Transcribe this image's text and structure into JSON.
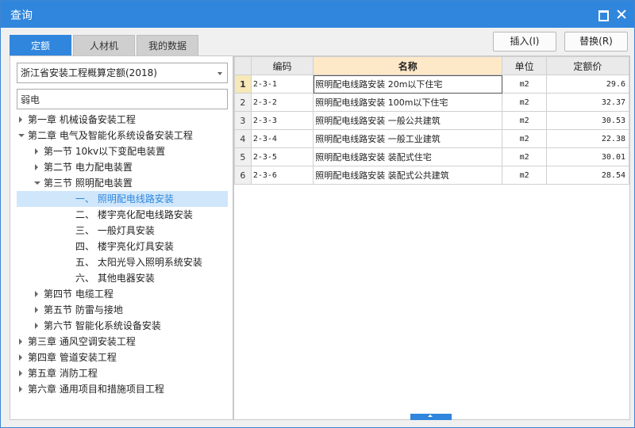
{
  "window": {
    "title": "查询"
  },
  "tabs": [
    {
      "label": "定额"
    },
    {
      "label": "人材机"
    },
    {
      "label": "我的数据"
    }
  ],
  "toolbar": {
    "insert_label": "插入(I)",
    "replace_label": "替换(R)"
  },
  "library": {
    "selected": "浙江省安装工程概算定额(2018)"
  },
  "search": {
    "value": "弱电"
  },
  "tree": [
    {
      "label": "第一章 机械设备安装工程",
      "level": 0,
      "arrow": "right"
    },
    {
      "label": "第二章 电气及智能化系统设备安装工程",
      "level": 0,
      "arrow": "down"
    },
    {
      "label": "第一节 10kv以下变配电装置",
      "level": 1,
      "arrow": "right"
    },
    {
      "label": "第二节 电力配电装置",
      "level": 1,
      "arrow": "right"
    },
    {
      "label": "第三节 照明配电装置",
      "level": 1,
      "arrow": "down"
    },
    {
      "label": "一、 照明配电线路安装",
      "level": 2,
      "arrow": "none",
      "selected": true
    },
    {
      "label": "二、 楼宇亮化配电线路安装",
      "level": 2,
      "arrow": "none"
    },
    {
      "label": "三、 一般灯具安装",
      "level": 2,
      "arrow": "none"
    },
    {
      "label": "四、 楼宇亮化灯具安装",
      "level": 2,
      "arrow": "none"
    },
    {
      "label": "五、 太阳光导入照明系统安装",
      "level": 2,
      "arrow": "none"
    },
    {
      "label": "六、 其他电器安装",
      "level": 2,
      "arrow": "none"
    },
    {
      "label": "第四节 电缆工程",
      "level": 1,
      "arrow": "right"
    },
    {
      "label": "第五节 防雷与接地",
      "level": 1,
      "arrow": "right"
    },
    {
      "label": "第六节 智能化系统设备安装",
      "level": 1,
      "arrow": "right"
    },
    {
      "label": "第三章 通风空调安装工程",
      "level": 0,
      "arrow": "right"
    },
    {
      "label": "第四章 管道安装工程",
      "level": 0,
      "arrow": "right"
    },
    {
      "label": "第五章 消防工程",
      "level": 0,
      "arrow": "right"
    },
    {
      "label": "第六章 通用项目和措施项目工程",
      "level": 0,
      "arrow": "right"
    }
  ],
  "table": {
    "headers": {
      "code": "编码",
      "name": "名称",
      "unit": "单位",
      "price": "定额价"
    },
    "rows": [
      {
        "n": "1",
        "code": "2-3-1",
        "name": "照明配电线路安装 20m以下住宅",
        "unit": "m2",
        "price": "29.6"
      },
      {
        "n": "2",
        "code": "2-3-2",
        "name": "照明配电线路安装 100m以下住宅",
        "unit": "m2",
        "price": "32.37"
      },
      {
        "n": "3",
        "code": "2-3-3",
        "name": "照明配电线路安装 一般公共建筑",
        "unit": "m2",
        "price": "30.53"
      },
      {
        "n": "4",
        "code": "2-3-4",
        "name": "照明配电线路安装 一般工业建筑",
        "unit": "m2",
        "price": "22.38"
      },
      {
        "n": "5",
        "code": "2-3-5",
        "name": "照明配电线路安装 装配式住宅",
        "unit": "m2",
        "price": "30.01"
      },
      {
        "n": "6",
        "code": "2-3-6",
        "name": "照明配电线路安装 装配式公共建筑",
        "unit": "m2",
        "price": "28.54"
      }
    ]
  },
  "colors": {
    "accent": "#2f86dc",
    "selected_bg": "#cfe6fb",
    "name_header_bg": "#fde8c7"
  }
}
